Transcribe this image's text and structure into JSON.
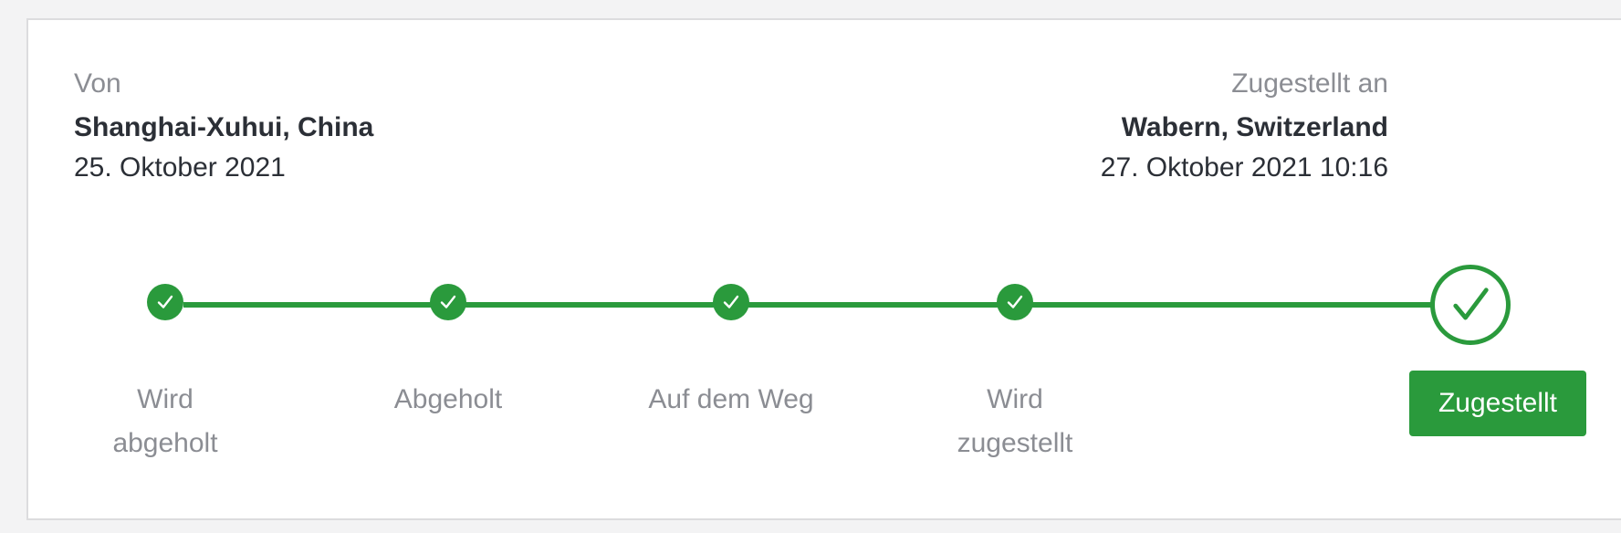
{
  "shipment": {
    "from_label": "Von",
    "from_place": "Shanghai-Xuhui, China",
    "from_date": "25. Oktober 2021",
    "to_label": "Zugestellt an",
    "to_place": "Wabern, Switzerland",
    "to_date": "27. Oktober 2021 10:16"
  },
  "progress": {
    "accent_color": "#2a9a3c",
    "steps": [
      {
        "label": "Wird abgeholt",
        "completed": true
      },
      {
        "label": "Abgeholt",
        "completed": true
      },
      {
        "label": "Auf dem Weg",
        "completed": true
      },
      {
        "label": "Wird zugestellt",
        "completed": true
      },
      {
        "label": "Zugestellt",
        "completed": true,
        "current": true
      }
    ],
    "icon": "check-icon"
  }
}
